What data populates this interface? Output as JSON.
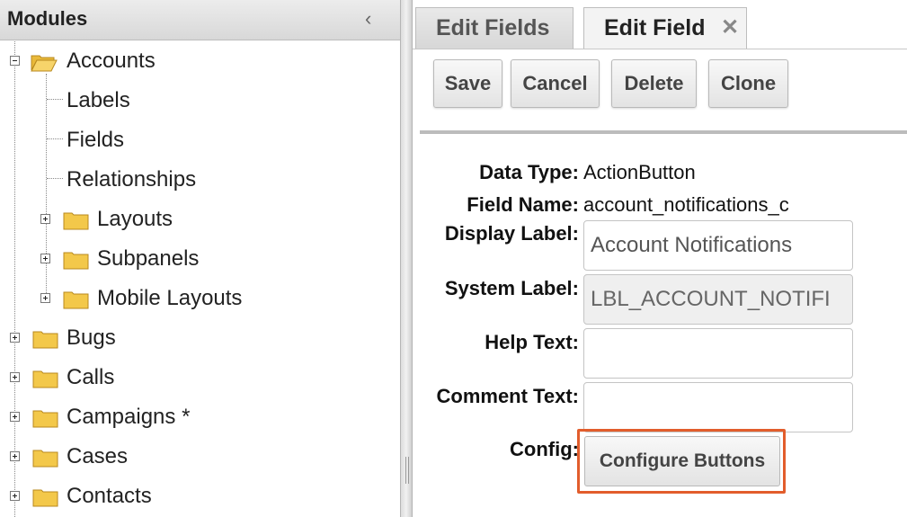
{
  "modules_panel": {
    "title": "Modules",
    "collapse_glyph": "‹",
    "tree": {
      "accounts": {
        "label": "Accounts",
        "children": [
          "Labels",
          "Fields",
          "Relationships",
          "Layouts",
          "Subpanels",
          "Mobile Layouts"
        ]
      },
      "modules": [
        "Bugs",
        "Calls",
        "Campaigns *",
        "Cases",
        "Contacts"
      ]
    }
  },
  "tabs": {
    "edit_fields": "Edit Fields",
    "edit_field": "Edit Field",
    "close_glyph": "✕"
  },
  "toolbar": {
    "save": "Save",
    "cancel": "Cancel",
    "delete": "Delete",
    "clone": "Clone"
  },
  "form": {
    "data_type_label": "Data Type:",
    "data_type_value": "ActionButton",
    "field_name_label": "Field Name:",
    "field_name_value": "account_notifications_c",
    "display_label_label": "Display Label:",
    "display_label_value": "Account Notifications",
    "system_label_label": "System Label:",
    "system_label_value": "LBL_ACCOUNT_NOTIFI",
    "help_text_label": "Help Text:",
    "help_text_value": "",
    "comment_text_label": "Comment Text:",
    "comment_text_value": "",
    "config_label": "Config:",
    "configure_buttons": "Configure Buttons"
  },
  "colors": {
    "highlight": "#e25d2c",
    "folder": "#f3c84a"
  }
}
